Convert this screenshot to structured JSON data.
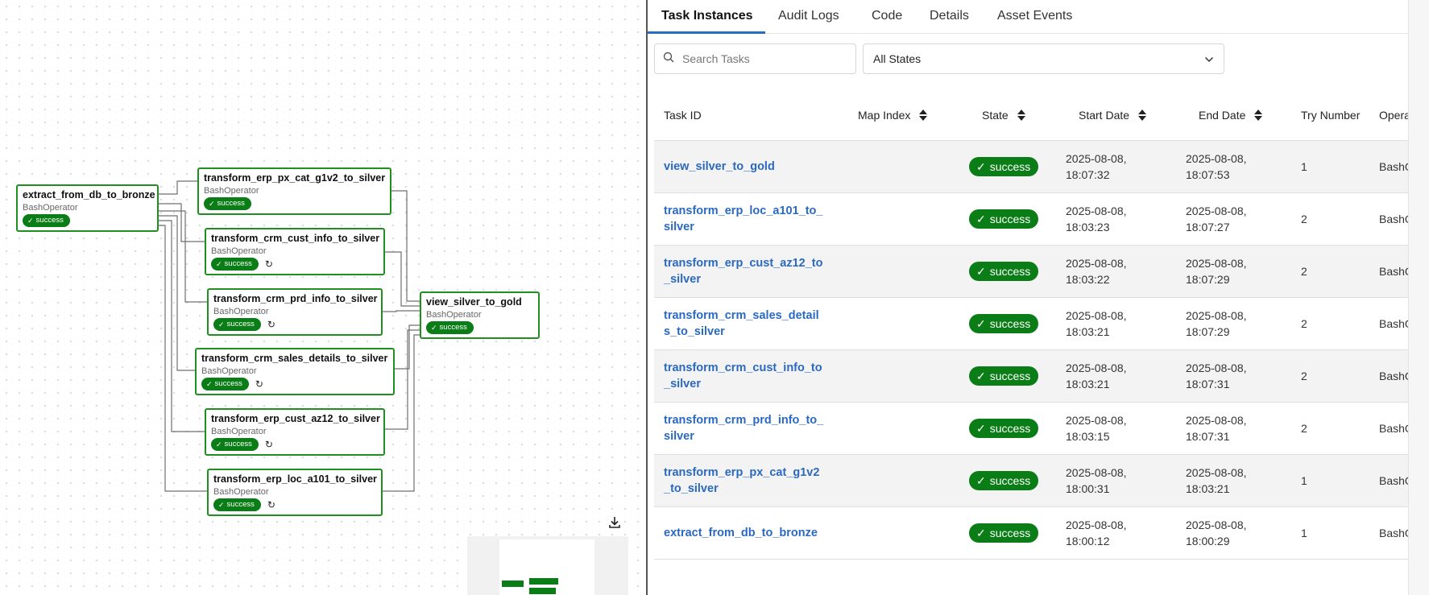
{
  "graph": {
    "nodes": [
      {
        "id": "extract_from_db_to_bronze",
        "operator": "BashOperator",
        "state": "success",
        "retry": false
      },
      {
        "id": "transform_erp_px_cat_g1v2_to_silver",
        "operator": "BashOperator",
        "state": "success",
        "retry": false
      },
      {
        "id": "transform_crm_cust_info_to_silver",
        "operator": "BashOperator",
        "state": "success",
        "retry": true
      },
      {
        "id": "transform_crm_prd_info_to_silver",
        "operator": "BashOperator",
        "state": "success",
        "retry": true
      },
      {
        "id": "transform_crm_sales_details_to_silver",
        "operator": "BashOperator",
        "state": "success",
        "retry": true
      },
      {
        "id": "transform_erp_cust_az12_to_silver",
        "operator": "BashOperator",
        "state": "success",
        "retry": true
      },
      {
        "id": "transform_erp_loc_a101_to_silver",
        "operator": "BashOperator",
        "state": "success",
        "retry": true
      },
      {
        "id": "view_silver_to_gold",
        "operator": "BashOperator",
        "state": "success",
        "retry": false
      }
    ],
    "icons": {
      "download": "download-icon",
      "retry": "retry-icon",
      "check": "check-icon"
    }
  },
  "tabs": [
    "Task Instances",
    "Audit Logs",
    "Code",
    "Details",
    "Asset Events"
  ],
  "active_tab": "Task Instances",
  "search": {
    "placeholder": "Search Tasks",
    "value": ""
  },
  "state_filter": {
    "selected": "All States"
  },
  "table": {
    "headers": [
      "Task ID",
      "Map Index",
      "State",
      "Start Date",
      "End Date",
      "Try Number",
      "Opera"
    ],
    "rows": [
      {
        "task_id": "view_silver_to_gold",
        "state": "success",
        "start": [
          "2025-08-08,",
          "18:07:32"
        ],
        "end": [
          "2025-08-08,",
          "18:07:53"
        ],
        "try": "1",
        "operator": "BashO"
      },
      {
        "task_id": "transform_erp_loc_a101_to_silver",
        "state": "success",
        "start": [
          "2025-08-08,",
          "18:03:23"
        ],
        "end": [
          "2025-08-08,",
          "18:07:27"
        ],
        "try": "2",
        "operator": "BashO"
      },
      {
        "task_id": "transform_erp_cust_az12_to_silver",
        "state": "success",
        "start": [
          "2025-08-08,",
          "18:03:22"
        ],
        "end": [
          "2025-08-08,",
          "18:07:29"
        ],
        "try": "2",
        "operator": "BashO"
      },
      {
        "task_id": "transform_crm_sales_details_to_silver",
        "state": "success",
        "start": [
          "2025-08-08,",
          "18:03:21"
        ],
        "end": [
          "2025-08-08,",
          "18:07:29"
        ],
        "try": "2",
        "operator": "BashO"
      },
      {
        "task_id": "transform_crm_cust_info_to_silver",
        "state": "success",
        "start": [
          "2025-08-08,",
          "18:03:21"
        ],
        "end": [
          "2025-08-08,",
          "18:07:31"
        ],
        "try": "2",
        "operator": "BashO"
      },
      {
        "task_id": "transform_crm_prd_info_to_silver",
        "state": "success",
        "start": [
          "2025-08-08,",
          "18:03:15"
        ],
        "end": [
          "2025-08-08,",
          "18:07:31"
        ],
        "try": "2",
        "operator": "BashO"
      },
      {
        "task_id": "transform_erp_px_cat_g1v2_to_silver",
        "state": "success",
        "start": [
          "2025-08-08,",
          "18:00:31"
        ],
        "end": [
          "2025-08-08,",
          "18:03:21"
        ],
        "try": "1",
        "operator": "BashO"
      },
      {
        "task_id": "extract_from_db_to_bronze",
        "state": "success",
        "start": [
          "2025-08-08,",
          "18:00:12"
        ],
        "end": [
          "2025-08-08,",
          "18:00:29"
        ],
        "try": "1",
        "operator": "BashO"
      }
    ]
  },
  "colors": {
    "success": "#0a7d16",
    "node_border": "#1f8f1f",
    "link": "#2a69c2",
    "tab_underline": "#2b6cc4"
  }
}
